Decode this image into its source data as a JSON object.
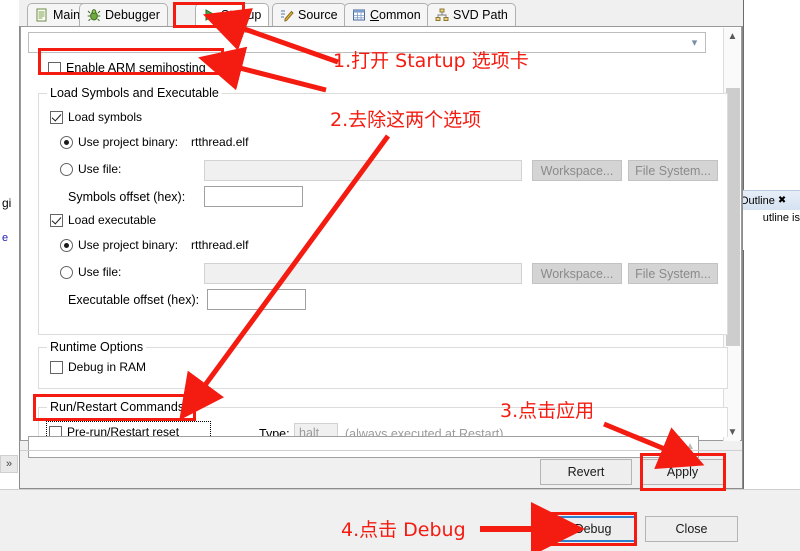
{
  "ide": {
    "left_fragment_text": "gi",
    "left_fragment_text2": "e",
    "left_expand_icon": "double-chevron-right-icon",
    "outline_tab_label": "Outline",
    "outline_tab_icon": "close-x-icon",
    "outline_body_text": "utline is"
  },
  "dialog": {
    "tabs": [
      {
        "label": "Main",
        "icon": "document-icon",
        "active": false
      },
      {
        "label": "Debugger",
        "icon": "bug-icon",
        "active": false
      },
      {
        "label": "Startup",
        "icon": "green-play-icon",
        "active": true
      },
      {
        "label": "Source",
        "icon": "pencil-edit-icon",
        "active": false
      },
      {
        "label": "Common",
        "icon": "table-icon",
        "active": false
      },
      {
        "label": "SVD Path",
        "icon": "hierarchy-icon",
        "active": false
      }
    ],
    "top_combo": {
      "value": "",
      "arrow_icon": "chevron-down-icon"
    },
    "semihosting": {
      "label": "Enable ARM semihosting",
      "checked": false
    },
    "load_group": {
      "title": "Load Symbols and Executable",
      "load_symbols": {
        "label": "Load symbols",
        "checked": true
      },
      "symbols_project_binary": {
        "label": "Use project binary:",
        "value": "rtthread.elf",
        "selected": true
      },
      "symbols_use_file": {
        "label": "Use file:",
        "value": "",
        "selected": false,
        "workspace_button": "Workspace...",
        "filesystem_button": "File System..."
      },
      "symbols_offset": {
        "label": "Symbols offset (hex):",
        "value": ""
      },
      "load_executable": {
        "label": "Load executable",
        "checked": true
      },
      "exec_project_binary": {
        "label": "Use project binary:",
        "value": "rtthread.elf",
        "selected": true
      },
      "exec_use_file": {
        "label": "Use file:",
        "value": "",
        "selected": false,
        "workspace_button": "Workspace...",
        "filesystem_button": "File System..."
      },
      "exec_offset": {
        "label": "Executable offset (hex):",
        "value": ""
      }
    },
    "runtime_group": {
      "title": "Runtime Options",
      "debug_in_ram": {
        "label": "Debug in RAM",
        "checked": false
      }
    },
    "runrestart_group": {
      "title": "Run/Restart Commands",
      "prerun_reset": {
        "label": "Pre-run/Restart reset",
        "checked": false
      },
      "type_label": "Type:",
      "type_value": "halt",
      "note": "(always executed at Restart)",
      "commands_value": "",
      "commands_scroll_icon": "chevron-up-icon"
    },
    "buttons": {
      "revert": "Revert",
      "apply": "Apply",
      "debug": "Debug",
      "close": "Close"
    }
  },
  "annotations": [
    {
      "id": "step1",
      "text": "1.打开 Startup 选项卡"
    },
    {
      "id": "step2",
      "text": "2.去除这两个选项"
    },
    {
      "id": "step3",
      "text": "3.点击应用"
    },
    {
      "id": "step4",
      "text": "4.点击 Debug"
    }
  ],
  "colors": {
    "annotation_red": "#f41b11",
    "dialog_bg": "#f0f0f0",
    "content_bg": "#ffffff",
    "focus_blue": "#2f7fd1"
  }
}
